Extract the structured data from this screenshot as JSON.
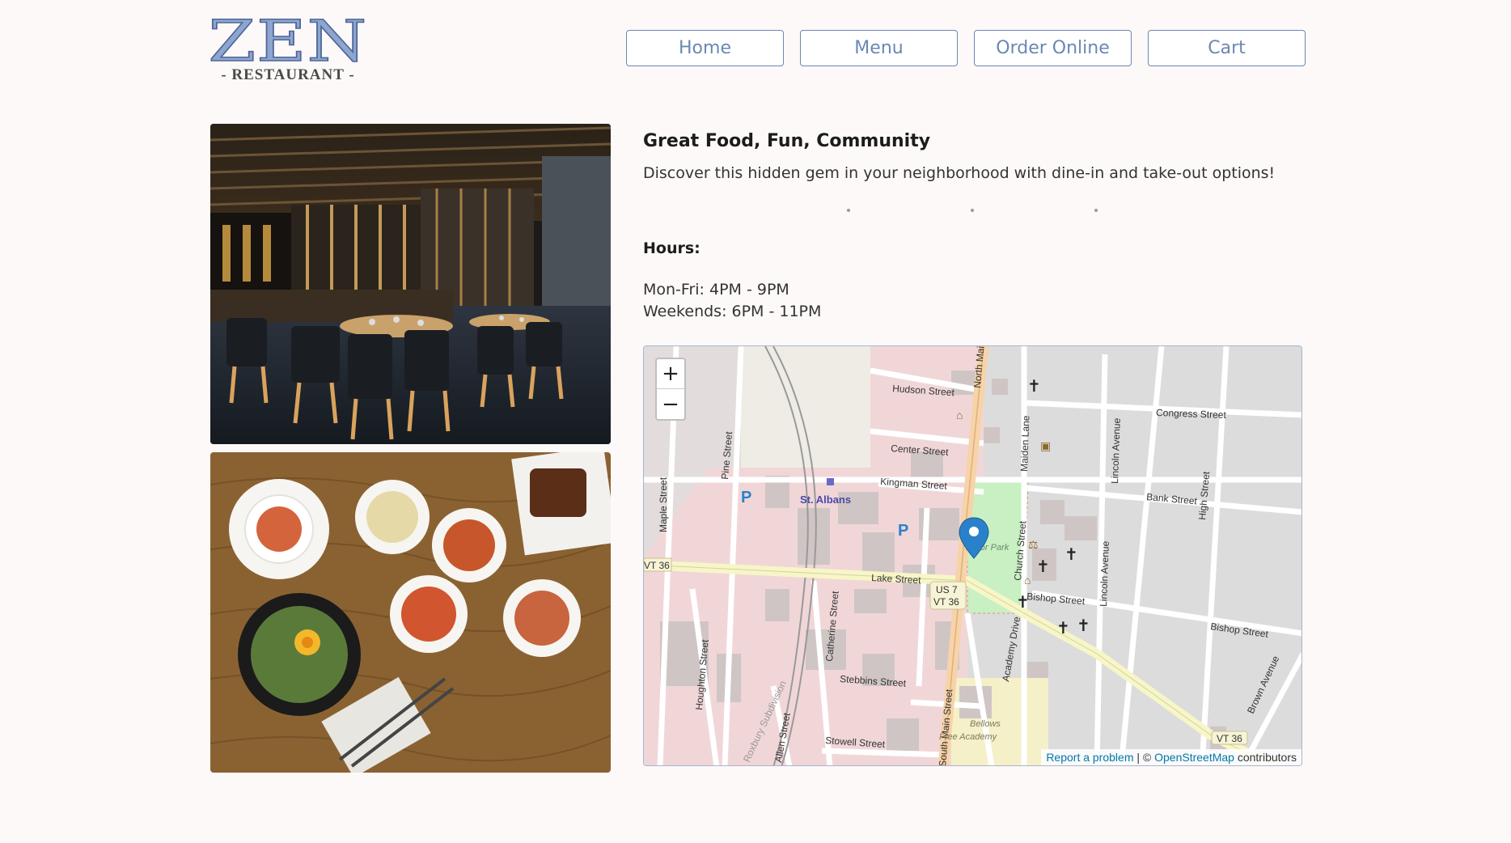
{
  "brand": {
    "logo_text": "ZEN",
    "logo_subtext": "- RESTAURANT -"
  },
  "nav": {
    "items": [
      "Home",
      "Menu",
      "Order Online",
      "Cart"
    ]
  },
  "main": {
    "tagline": "Great Food, Fun, Community",
    "description": "Discover this hidden gem in your neighborhood with dine-in and take-out options!",
    "hours_title": "Hours:",
    "hours": [
      "Mon-Fri: 4PM - 9PM",
      "Weekends: 6PM - 11PM"
    ]
  },
  "images": [
    {
      "name": "restaurant-interior-photo"
    },
    {
      "name": "food-dishes-photo"
    }
  ],
  "map": {
    "zoom_in": "+",
    "zoom_out": "−",
    "attribution": {
      "report": "Report a problem",
      "sep": " | © ",
      "osm": "OpenStreetMap",
      "suffix": " contributors"
    },
    "labels": {
      "hudson": "Hudson Street",
      "center": "Center Street",
      "kingman": "Kingman Street",
      "congress": "Congress Street",
      "bank": "Bank Street",
      "lake": "Lake Street",
      "bishop1": "Bishop Street",
      "bishop2": "Bishop Street",
      "stebbins": "Stebbins Street",
      "stowell": "Stowell Street",
      "stalbans": "St. Albans",
      "taylor": "Taylor Park",
      "bellows1": "Bellows",
      "bellows2": "Free Academy",
      "us7": "US 7",
      "vt36a": "VT 36",
      "vt36b": "VT 36",
      "vt36c": "VT 36",
      "maple": "Maple Street",
      "pine": "Pine Street",
      "houghton": "Houghton Street",
      "catherine": "Catherine Street",
      "allen": "Allen Street",
      "roxbury": "Roxbury Subdivision",
      "southmain": "South Main Street",
      "northmain": "North Main",
      "church": "Church Street",
      "maiden": "Maiden Lane",
      "lincoln1": "Lincoln Avenue",
      "lincoln2": "Lincoln Avenue",
      "high": "High Street",
      "brown": "Brown Avenue",
      "academy": "Academy Drive"
    }
  },
  "colors": {
    "nav_accent": "#6b88b3",
    "background": "#fdf9f8",
    "map_marker": "#2a81cb"
  }
}
